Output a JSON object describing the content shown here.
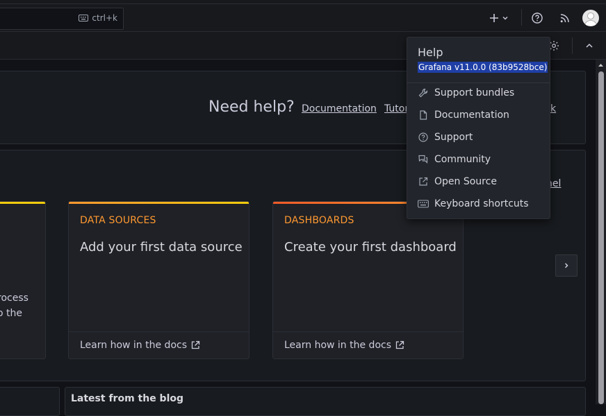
{
  "topbar": {
    "search_shortcut": "ctrl+k",
    "icons": [
      "plus-icon",
      "chevron-down-icon",
      "help-icon",
      "rss-icon",
      "avatar"
    ]
  },
  "help_banner": {
    "heading": "Need help?",
    "links": [
      "Documentation",
      "Tutor",
      "k"
    ]
  },
  "side_link_fragment": "nel",
  "left_card_text": [
    "rocess",
    "o the"
  ],
  "cards": [
    {
      "label": "DATA SOURCES",
      "heading": "Add your first data source",
      "footer": "Learn how in the docs",
      "accent": "#f2cc0c"
    },
    {
      "label": "DASHBOARDS",
      "heading": "Create your first dashboard",
      "footer": "Learn how in the docs",
      "accent": "#f05a28"
    }
  ],
  "bottom": {
    "blog_title": "Latest from the blog"
  },
  "help_menu": {
    "title": "Help",
    "version": "Grafana v11.0.0 (83b9528bce)",
    "items": [
      {
        "label": "Support bundles",
        "icon": "wrench-icon"
      },
      {
        "label": "Documentation",
        "icon": "file-icon"
      },
      {
        "label": "Support",
        "icon": "question-circle-icon"
      },
      {
        "label": "Community",
        "icon": "comments-icon"
      },
      {
        "label": "Open Source",
        "icon": "external-link-icon"
      },
      {
        "label": "Keyboard shortcuts",
        "icon": "keyboard-icon"
      }
    ]
  },
  "colors": {
    "accent_orange": "#ff9830",
    "selection_blue": "#1f3fa6"
  }
}
